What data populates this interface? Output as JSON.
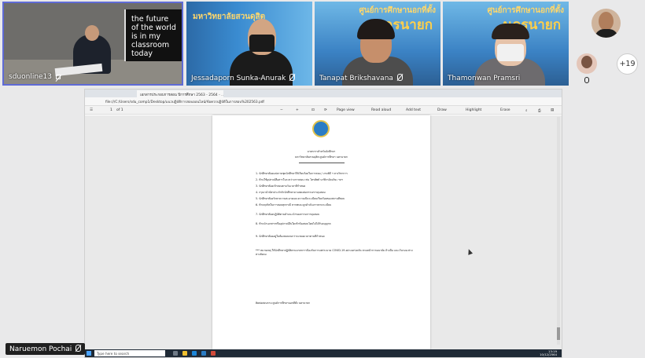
{
  "tiles": {
    "presenter": {
      "name": "sduonline13",
      "board_lines": [
        "the future",
        "of the world",
        "is in my",
        "classroom",
        "today"
      ]
    },
    "t1": {
      "name": "Jessadaporn Sunka-Anurak",
      "banner": "มหาวิทยาลัยสวนดุสิต"
    },
    "t2": {
      "name": "Tanapat Brikshavana",
      "banner_top": "ศูนย์การศึกษานอกที่ตั้ง",
      "banner_big": "นครนายก"
    },
    "t3": {
      "name": "Thamonwan Pramsri",
      "banner_top": "ศูนย์การศึกษานอกที่ตั้ง",
      "banner_big": "นครนายก"
    }
  },
  "participants": {
    "more_count": "+19"
  },
  "self_view": {
    "name": "Naruemon Pochai"
  },
  "browser": {
    "tab_labels": [
      "",
      "เอกสารประกอบการสอน ปีการศึกษา 2563 - 2564 - ..."
    ],
    "url": "file:///C:/Users/sdu_comp1/Desktop/แนวปฏิบัติการสอบออนไลน์/ข้อควรปฏิบัติในการสอบ%202563.pdf",
    "toolbar": {
      "page_indicator": "1",
      "of_pages": "of 1",
      "page_view": "Page view",
      "read_aloud": "Read aloud",
      "add_text": "Add text",
      "draw": "Draw",
      "highlight": "Highlight",
      "erase": "Erase"
    }
  },
  "pdf": {
    "header_1": "มาตรการสำหรับนักศึกษา",
    "header_2": "มหาวิทยาลัยสวนดุสิต ศูนย์การศึกษา นครนายก",
    "items": [
      "1. นักศึกษาต้องแต่งกายชุดนักศึกษาให้เรียบร้อยในการสอบ / งานพิธี ฯ ทางวิชาการ",
      "2. ห้ามใช้อุปกรณ์สื่อสารในระหว่างการสอบ เช่น โทรศัพท์ นาฬิกาอัจฉริยะ ฯลฯ",
      "3. นักศึกษาต้องเข้าสอบตามวันเวลาที่กำหนด",
      "4. กรุณานำบัตรประจำตัวนักศึกษามาแสดงต่อกรรมการคุมสอบ",
      "5. นักศึกษาต้องรักษาความสะอาดและความเป็นระเบียบเรียบร้อยของสถานที่สอบ",
      "6. ห้ามทุจริตในการสอบทุกกรณี หากพบจะถูกดำเนินการตามระเบียบ",
      "7. นักศึกษาต้องปฏิบัติตามคำแนะนำของกรรมการคุมสอบ",
      "8. ห้ามนำเอกสารหรืออุปกรณ์อื่นใดเข้าห้องสอบโดยไม่ได้รับอนุญาต",
      "9. นักศึกษาต้องอยู่ในห้องสอบจนกว่าจะหมดเวลาตามที่กำหนด"
    ],
    "note": "*** หมายเหตุ ให้นักศึกษาปฏิบัติตามมาตรการป้องกันการแพร่ระบาด COVID-19 อย่างเคร่งครัด สวมหน้ากากอนามัย ล้างมือ และเว้นระยะห่างทางสังคม",
    "contact": "ติดต่อสอบถาม ศูนย์การศึกษานอกที่ตั้ง นครนายก"
  },
  "taskbar": {
    "search_placeholder": "Type here to search",
    "time": "13:19",
    "date": "10/12/2564"
  }
}
